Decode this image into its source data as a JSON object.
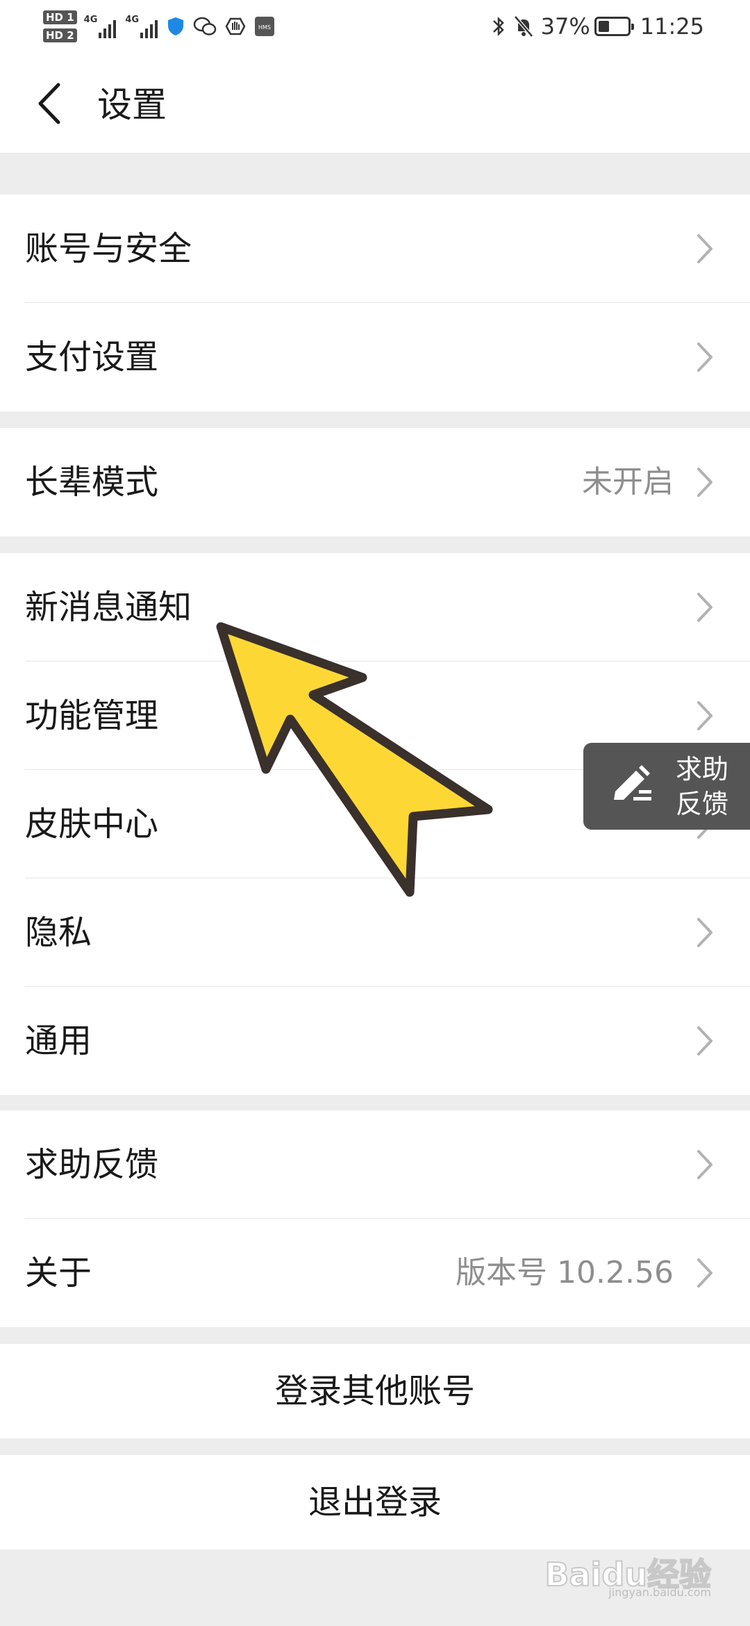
{
  "status_bar": {
    "sim1": "HD 1",
    "sim2": "HD 2",
    "network1": "4G",
    "network2": "4G",
    "hms_label": "HMS",
    "battery_percent": "37%",
    "battery_level": 0.37,
    "time": "11:25"
  },
  "header": {
    "title": "设置"
  },
  "groups": [
    {
      "items": [
        {
          "label": "账号与安全"
        },
        {
          "label": "支付设置"
        }
      ]
    },
    {
      "items": [
        {
          "label": "长辈模式",
          "value": "未开启"
        }
      ]
    },
    {
      "items": [
        {
          "label": "新消息通知"
        },
        {
          "label": "功能管理"
        },
        {
          "label": "皮肤中心"
        },
        {
          "label": "隐私"
        },
        {
          "label": "通用"
        }
      ]
    },
    {
      "items": [
        {
          "label": "求助反馈"
        },
        {
          "label": "关于",
          "value": "版本号 10.2.56"
        }
      ]
    }
  ],
  "buttons": {
    "switch_account": "登录其他账号",
    "logout": "退出登录"
  },
  "floating_help": {
    "line1": "求助",
    "line2": "反馈"
  },
  "watermark": {
    "brand": "Baidu经验",
    "url": "jingyan.baidu.com"
  },
  "colors": {
    "page_bg": "#ededed",
    "card_bg": "#ffffff",
    "text": "#191919",
    "secondary_text": "#8e8e8e",
    "arrow_fill": "#fdd835",
    "arrow_outline": "#3a302c",
    "fab_bg": "#555555"
  },
  "icons": {
    "back": "chevron-left-icon",
    "row_chevron": "chevron-right-icon",
    "fab": "pencil-icon",
    "annotation": "arrow-pointer"
  }
}
